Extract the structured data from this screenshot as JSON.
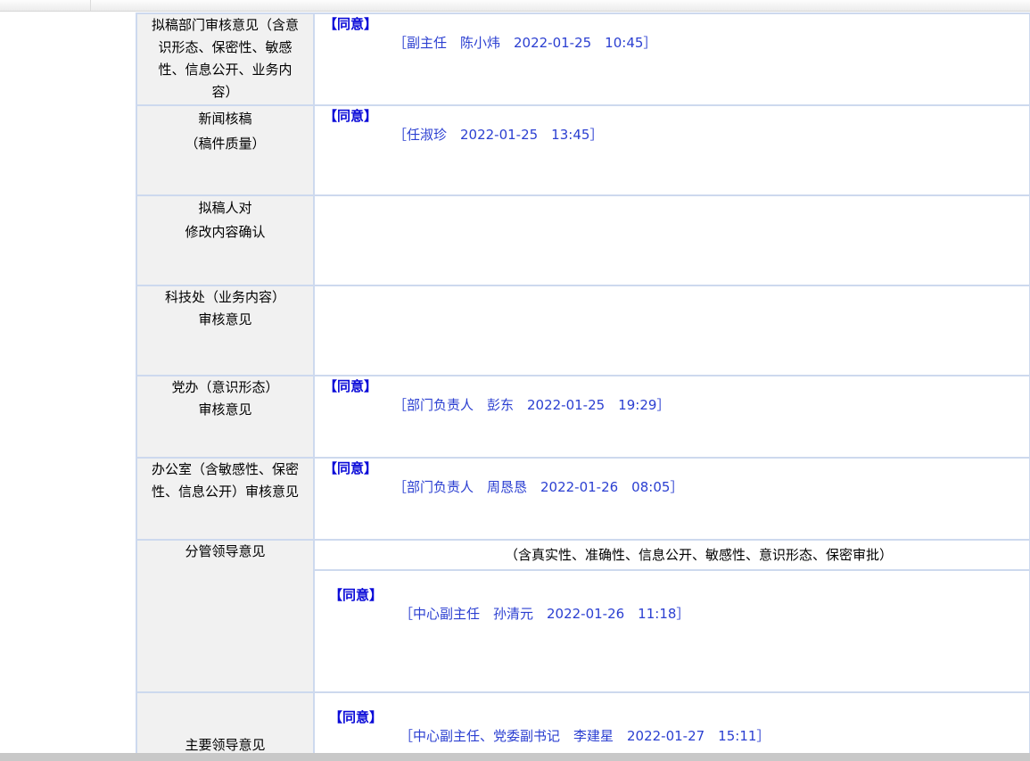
{
  "rows": [
    {
      "label_lines": [
        "拟稿部门审核意见（含意",
        "识形态、保密性、敏感",
        "性、信息公开、业务内",
        "容）"
      ],
      "opinion": "【同意】",
      "signature": "［副主任　陈小炜　2022-01-25　10:45］"
    },
    {
      "label_lines": [
        "新闻核稿",
        "（稿件质量）"
      ],
      "opinion": "【同意】",
      "signature": "［任淑珍　2022-01-25　13:45］"
    },
    {
      "label_lines": [
        "拟稿人对",
        "修改内容确认"
      ]
    },
    {
      "label_lines": [
        "科技处（业务内容）",
        "审核意见"
      ]
    },
    {
      "label_lines": [
        "党办（意识形态）",
        "审核意见"
      ],
      "opinion": "【同意】",
      "signature": "［部门负责人　彭东　2022-01-25　19:29］"
    },
    {
      "label_lines": [
        "办公室（含敏感性、保密",
        "性、信息公开）审核意见"
      ],
      "opinion": "【同意】",
      "signature": "［部门负责人　周恳恳　2022-01-26　08:05］"
    },
    {
      "label_lines": [
        "分管领导意见"
      ],
      "note": "（含真实性、准确性、信息公开、敏感性、意识形态、保密审批）",
      "opinion": "【同意】",
      "signature": "［中心副主任　孙清元　2022-01-26　11:18］"
    },
    {
      "label_lines": [
        "主要领导意见"
      ],
      "opinion": "【同意】",
      "signature": "［中心副主任、党委副书记　李建星　2022-01-27　15:11］"
    }
  ]
}
